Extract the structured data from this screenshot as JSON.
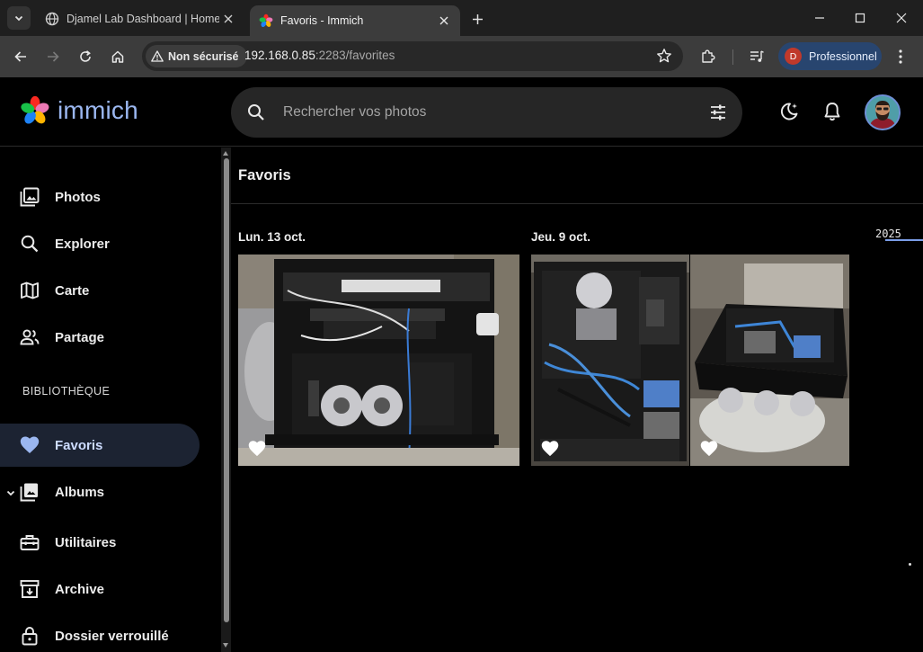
{
  "browser": {
    "tabs": [
      {
        "title": "Djamel Lab Dashboard | HomeL",
        "active": false
      },
      {
        "title": "Favoris - Immich",
        "active": true
      }
    ],
    "security_label": "Non sécurisé",
    "url_host": "192.168.0.85",
    "url_path": ":2283/favorites",
    "profile": {
      "initial": "D",
      "label": "Professionnel"
    },
    "colors": {
      "tabbar": "#1f1f1f",
      "toolbar": "#3c3c3c",
      "profile_chip": "#28456f"
    }
  },
  "app": {
    "logo_text": "immich",
    "search": {
      "placeholder": "Rechercher vos photos"
    },
    "header_icons": [
      "theme-toggle-icon",
      "notifications-icon",
      "user-avatar"
    ],
    "colors": {
      "accent": "#9bb7f0",
      "active_nav_bg": "#1c2332",
      "search_bg": "#262626"
    }
  },
  "sidebar": {
    "items": [
      {
        "label": "Photos",
        "icon": "photos-icon"
      },
      {
        "label": "Explorer",
        "icon": "search-icon"
      },
      {
        "label": "Carte",
        "icon": "map-icon"
      },
      {
        "label": "Partage",
        "icon": "sharing-icon"
      }
    ],
    "library_heading": "BIBLIOTHÈQUE",
    "library_items": [
      {
        "label": "Favoris",
        "icon": "heart-icon",
        "active": true
      },
      {
        "label": "Albums",
        "icon": "albums-icon",
        "expandable": true
      },
      {
        "label": "Utilitaires",
        "icon": "toolbox-icon"
      },
      {
        "label": "Archive",
        "icon": "archive-icon"
      },
      {
        "label": "Dossier verrouillé",
        "icon": "lock-icon"
      }
    ]
  },
  "main": {
    "title": "Favoris",
    "groups": [
      {
        "date": "Lun. 13 oct.",
        "photos": [
          {
            "subject": "server rack",
            "favorite": true
          }
        ]
      },
      {
        "date": "Jeu. 9 oct.",
        "photos": [
          {
            "subject": "pc case interior",
            "favorite": true
          },
          {
            "subject": "pc case on table",
            "favorite": true
          }
        ]
      }
    ],
    "timeline": {
      "year": "2025"
    }
  }
}
